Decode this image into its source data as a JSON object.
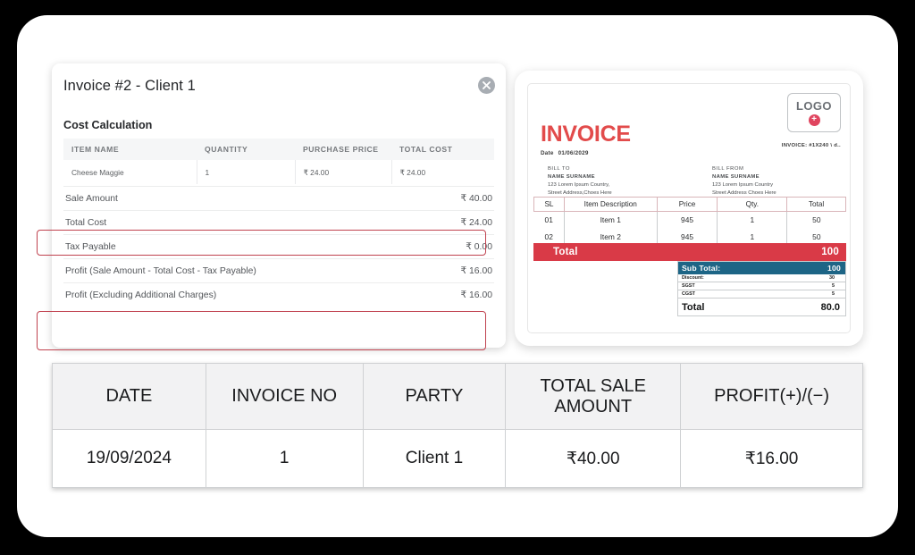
{
  "modal": {
    "title": "Invoice #2 - Client 1",
    "close_icon": "close-icon",
    "section_label": "Cost Calculation",
    "items_table": {
      "headers": [
        "ITEM NAME",
        "QUANTITY",
        "PURCHASE PRICE",
        "TOTAL COST"
      ],
      "rows": [
        {
          "name": "Cheese Maggie",
          "quantity": "1",
          "purchase_price": "₹ 24.00",
          "total_cost": "₹ 24.00"
        }
      ]
    },
    "summary": [
      {
        "label": "Sale Amount",
        "value": "₹ 40.00",
        "highlighted": false
      },
      {
        "label": "Total Cost",
        "value": "₹ 24.00",
        "highlighted": true
      },
      {
        "label": "Tax Payable",
        "value": "₹ 0.00",
        "highlighted": false
      },
      {
        "label": "Profit (Sale Amount - Total Cost - Tax Payable)",
        "value": "₹ 16.00",
        "highlighted": false
      },
      {
        "label": "Profit (Excluding Additional Charges)",
        "value": "₹ 16.00",
        "highlighted": true
      }
    ],
    "highlight_color": "#c0424f"
  },
  "invoice_preview": {
    "heading": "INVOICE",
    "heading_color": "#e24b4b",
    "date_label": "Date",
    "date_value": "01/06/2029",
    "logo_text": "LOGO",
    "logo_plus": "+",
    "invoice_no": "INVOICE: #1X240 \\ d..",
    "bill_to": {
      "head": "BILL TO",
      "name": "NAME SURNAME",
      "line1": "123 Lorem Ipsum Country,",
      "line2": "Street Address,Choes Here"
    },
    "bill_from": {
      "head": "BILL FROM",
      "name": "NAME SURNAME",
      "line1": "123 Lorem Ipsum Country",
      "line2": "Street Address Choes Here"
    },
    "table": {
      "headers": [
        "SL",
        "Item Description",
        "Price",
        "Qty.",
        "Total"
      ],
      "rows": [
        {
          "sl": "01",
          "desc": "Item 1",
          "price": "945",
          "qty": "1",
          "total": "50"
        },
        {
          "sl": "02",
          "desc": "Item 2",
          "price": "945",
          "qty": "1",
          "total": "50"
        }
      ]
    },
    "total_bar": {
      "label": "Total",
      "value": "100",
      "color": "#d93a47"
    },
    "totals": {
      "subtotal_label": "Sub Total:",
      "subtotal_value": "100",
      "subtotal_color": "#1d6586",
      "rows": [
        {
          "label": "Discount:",
          "value": "30"
        },
        {
          "label": "SGST",
          "value": "5"
        },
        {
          "label": "CGST",
          "value": "5"
        }
      ],
      "grand_label": "Total",
      "grand_value": "80.0"
    }
  },
  "records_table": {
    "headers": [
      "DATE",
      "INVOICE NO",
      "PARTY",
      "TOTAL SALE AMOUNT",
      "PROFIT(+)/(−)"
    ],
    "rows": [
      {
        "date": "19/09/2024",
        "invoice_no": "1",
        "party": "Client 1",
        "total_sale_amount": "₹40.00",
        "profit": "₹16.00"
      }
    ],
    "profit_color": "#22bb44"
  }
}
